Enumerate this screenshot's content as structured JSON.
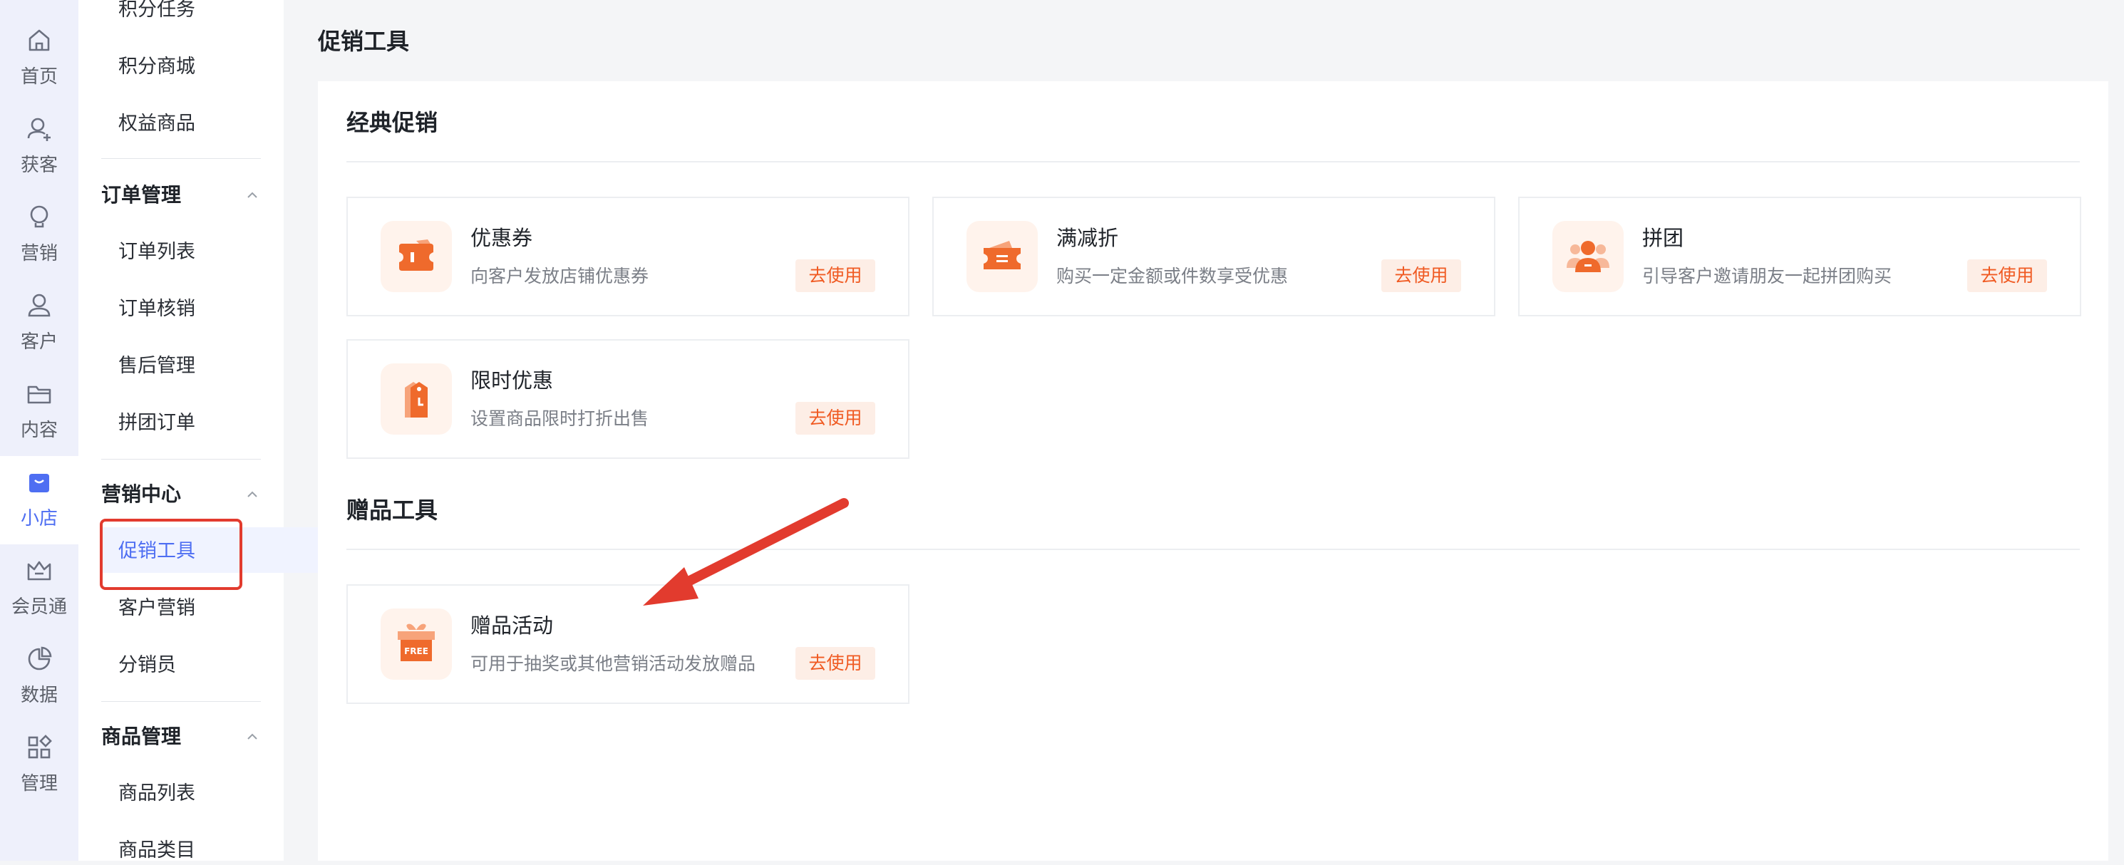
{
  "rail": {
    "items": [
      {
        "label": "首页",
        "icon": "home-icon"
      },
      {
        "label": "获客",
        "icon": "user-plus-icon"
      },
      {
        "label": "营销",
        "icon": "bulb-icon"
      },
      {
        "label": "客户",
        "icon": "user-icon"
      },
      {
        "label": "内容",
        "icon": "folder-icon"
      },
      {
        "label": "小店",
        "icon": "shop-icon"
      },
      {
        "label": "会员通",
        "icon": "crown-icon"
      },
      {
        "label": "数据",
        "icon": "pie-chart-icon"
      },
      {
        "label": "管理",
        "icon": "grid-icon"
      }
    ],
    "active_index": 5
  },
  "subnav": {
    "top_items": [
      "积分任务",
      "积分商城",
      "权益商品"
    ],
    "groups": [
      {
        "title": "订单管理",
        "items": [
          "订单列表",
          "订单核销",
          "售后管理",
          "拼团订单"
        ]
      },
      {
        "title": "营销中心",
        "items": [
          "促销工具",
          "客户营销",
          "分销员"
        ]
      },
      {
        "title": "商品管理",
        "items": [
          "商品列表",
          "商品类目"
        ]
      }
    ],
    "active_item": "促销工具"
  },
  "main": {
    "page_title": "促销工具",
    "sections": [
      {
        "title": "经典促销",
        "cards": [
          {
            "title": "优惠券",
            "desc": "向客户发放店铺优惠券",
            "button": "去使用",
            "icon": "coupon-icon"
          },
          {
            "title": "满减折",
            "desc": "购买一定金额或件数享受优惠",
            "button": "去使用",
            "icon": "discount-ticket-icon"
          },
          {
            "title": "拼团",
            "desc": "引导客户邀请朋友一起拼团购买",
            "button": "去使用",
            "icon": "group-buy-icon"
          },
          {
            "title": "限时优惠",
            "desc": "设置商品限时打折出售",
            "button": "去使用",
            "icon": "price-tag-clock-icon"
          }
        ]
      },
      {
        "title": "赠品工具",
        "cards": [
          {
            "title": "赠品活动",
            "desc": "可用于抽奖或其他营销活动发放赠品",
            "button": "去使用",
            "icon": "free-gift-icon"
          }
        ]
      }
    ]
  },
  "colors": {
    "accent": "#4e6ef2",
    "orange": "#f05a22",
    "highlight_red": "#e23b2e"
  },
  "icon_badge_text": "FREE"
}
